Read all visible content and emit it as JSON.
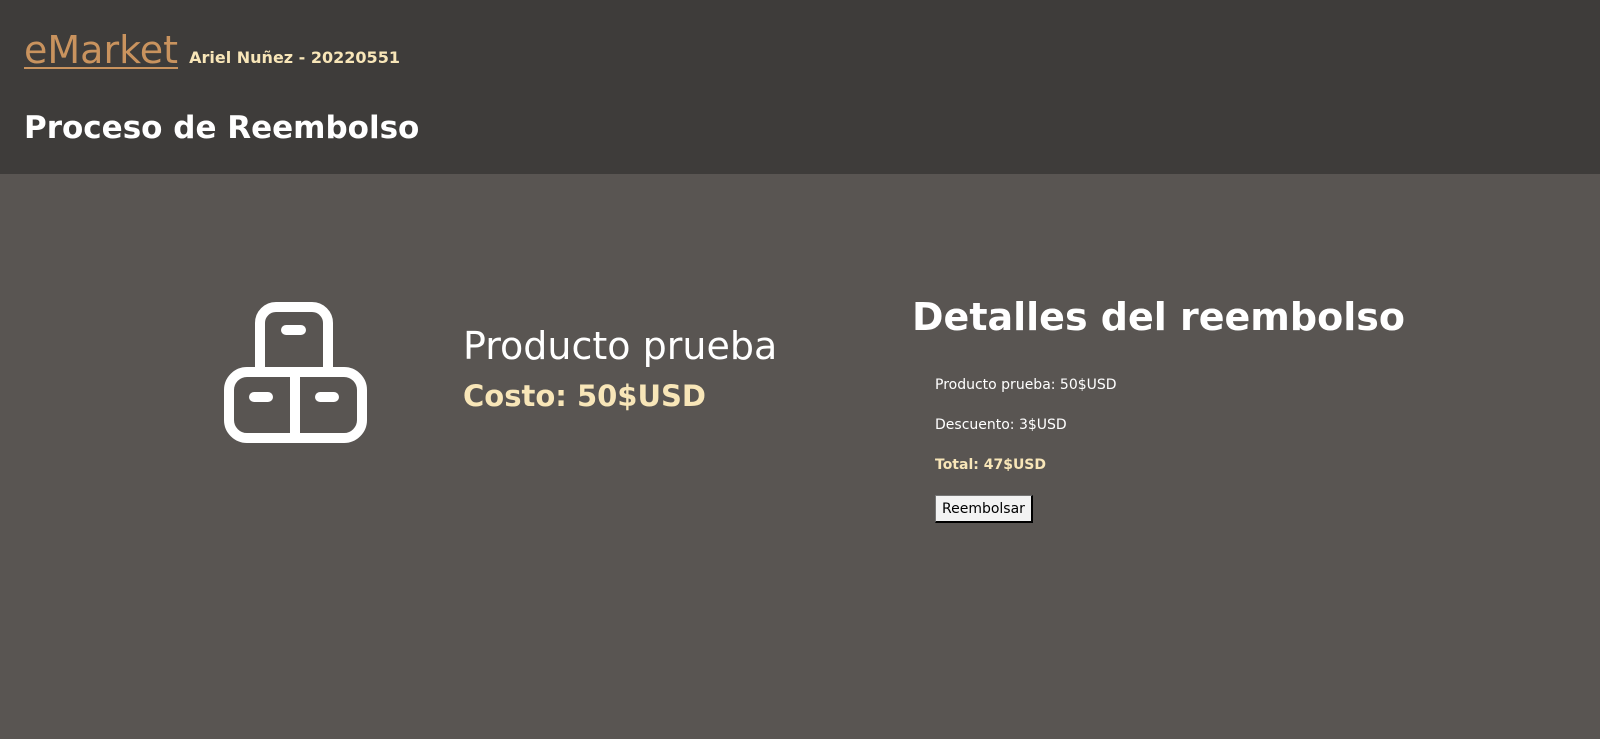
{
  "header": {
    "brand": "eMarket",
    "author": "Ariel Nuñez - 20220551",
    "page_title": "Proceso de Reembolso"
  },
  "product": {
    "icon": "package-boxes-icon",
    "name": "Producto prueba",
    "cost": "Costo: 50$USD"
  },
  "details": {
    "title": "Detalles del reembolso",
    "product_line": "Producto prueba: 50$USD",
    "discount_line": "Descuento: 3$USD",
    "total_line": "Total: 47$USD",
    "button_label": "Reembolsar"
  },
  "colors": {
    "header_bg": "#3e3c3a",
    "page_bg": "#595552",
    "brand": "#c9935e",
    "accent": "#f8e6b8"
  }
}
